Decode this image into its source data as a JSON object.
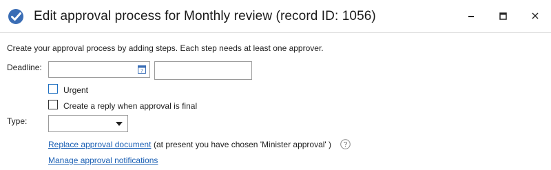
{
  "window": {
    "title": "Edit approval process for Monthly review (record ID: 1056)",
    "accent_color": "#2b6cb0"
  },
  "controls": {
    "minimize_icon": "minimize-icon",
    "maximize_icon": "maximize-icon",
    "close_icon": "close-icon"
  },
  "form": {
    "intro": "Create your approval process by adding steps. Each step needs at least one approver.",
    "deadline_label": "Deadline:",
    "deadline_date_value": "",
    "deadline_time_value": "",
    "calendar_icon_day": "7",
    "urgent_label": "Urgent",
    "urgent_checked": false,
    "reply_label": "Create a reply when approval is final",
    "reply_checked": false,
    "type_label": "Type:",
    "type_selected": ""
  },
  "links": {
    "replace_document": "Replace approval document",
    "current_choice_note": "(at present you have chosen 'Minister approval' )",
    "manage_notifications": "Manage approval notifications",
    "link_color": "#1a5fb4"
  }
}
